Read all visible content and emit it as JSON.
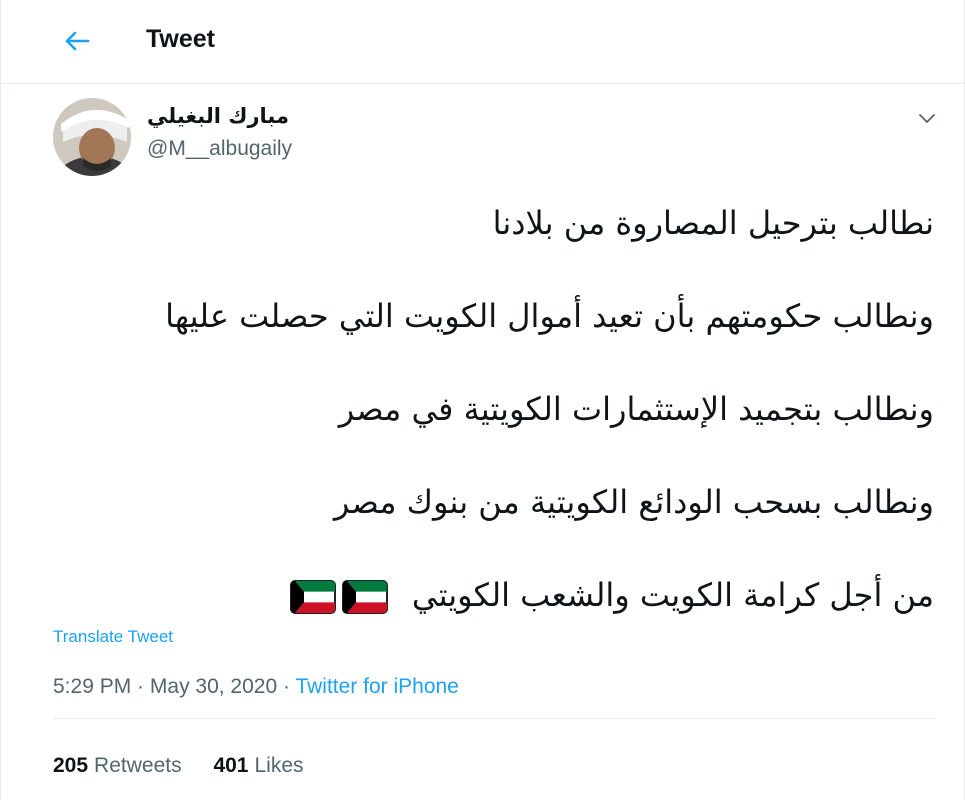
{
  "header": {
    "title": "Tweet",
    "back_icon": "arrow-left-icon"
  },
  "tweet": {
    "author_name": "مبارك البغيلي",
    "author_handle": "@M__albugaily",
    "more_icon": "chevron-down-icon",
    "lines": [
      "نطالب بترحيل المصاروة من بلادنا",
      "ونطالب حكومتهم بأن تعيد أموال الكويت التي حصلت عليها",
      "ونطالب بتجميد الإستثمارات الكويتية في مصر",
      "ونطالب بسحب الودائع الكويتية من بنوك مصر",
      "من أجل كرامة الكويت والشعب الكويتي"
    ],
    "emoji": [
      "kuwait-flag",
      "kuwait-flag"
    ],
    "translate_label": "Translate Tweet",
    "time": "5:29 PM",
    "separator": " · ",
    "date": "May 30, 2020",
    "source": "Twitter for iPhone"
  },
  "stats": {
    "retweets_count": "205",
    "retweets_label": "Retweets",
    "likes_count": "401",
    "likes_label": "Likes"
  },
  "colors": {
    "accent": "#1da1f2",
    "secondary_text": "#536471",
    "border": "#e6ecf0",
    "flag_green": "#007a3d",
    "flag_red": "#ce1126",
    "flag_black": "#000000"
  }
}
